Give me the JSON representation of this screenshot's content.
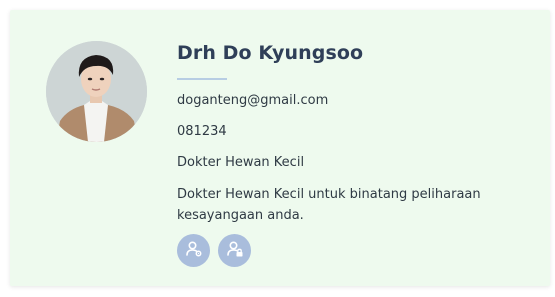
{
  "profile": {
    "name": "Drh Do Kyungsoo",
    "email": "doganteng@gmail.com",
    "phone": "081234",
    "specialty": "Dokter Hewan Kecil",
    "description": "Dokter Hewan Kecil untuk binatang peliharaan kesayangaan anda."
  },
  "colors": {
    "card_bg": "#eefaee",
    "name": "#2f3f58",
    "accent": "#a9bddc",
    "divider": "#b7cde3"
  },
  "actions": [
    {
      "icon": "user-settings-icon"
    },
    {
      "icon": "user-lock-icon"
    }
  ]
}
